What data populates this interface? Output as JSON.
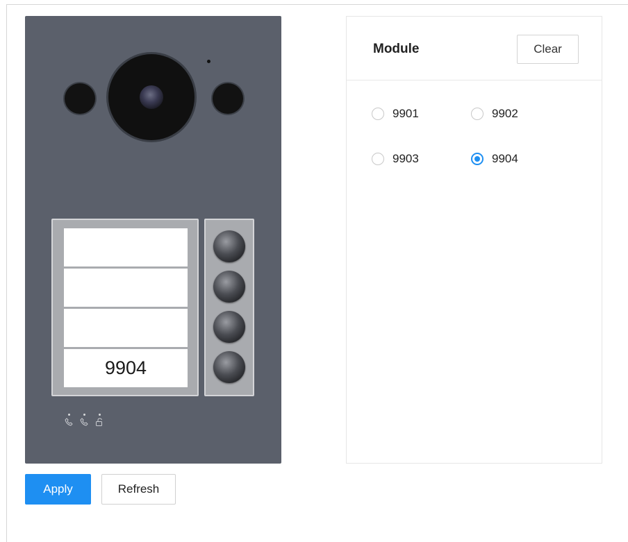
{
  "device": {
    "slots": [
      "",
      "",
      "",
      "9904"
    ]
  },
  "actions": {
    "apply_label": "Apply",
    "refresh_label": "Refresh"
  },
  "module": {
    "title": "Module",
    "clear_label": "Clear",
    "options": [
      {
        "label": "9901",
        "checked": false
      },
      {
        "label": "9902",
        "checked": false
      },
      {
        "label": "9903",
        "checked": false
      },
      {
        "label": "9904",
        "checked": true
      }
    ]
  },
  "colors": {
    "accent": "#1e8ff2",
    "device_body": "#5b606b"
  },
  "icons": [
    "call-icon",
    "call-icon",
    "unlock-icon"
  ]
}
